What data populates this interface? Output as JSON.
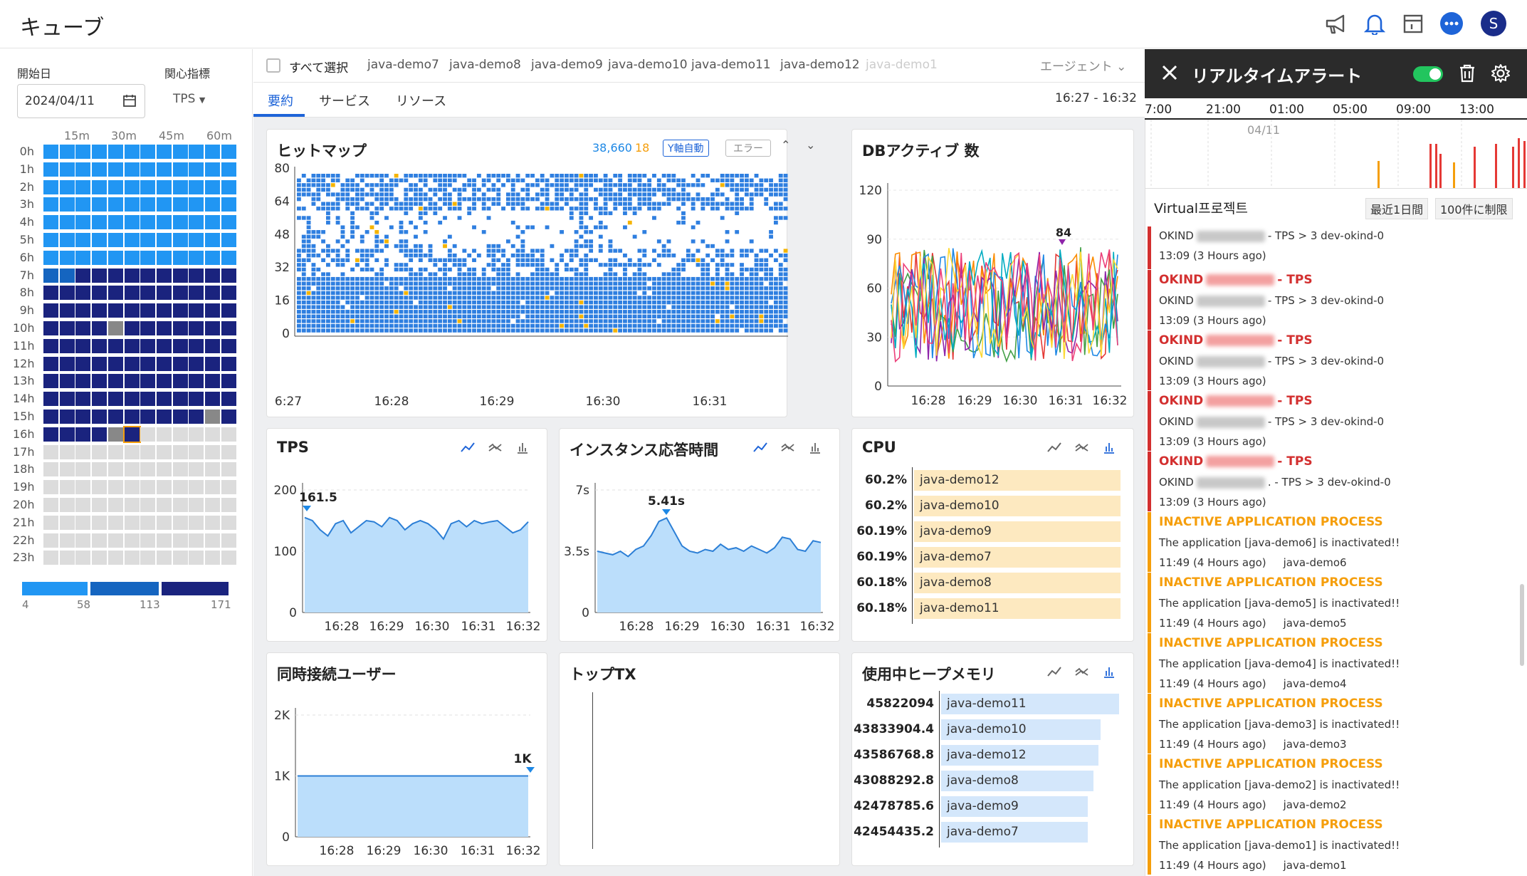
{
  "app": {
    "title": "キューブ"
  },
  "topbar": {
    "icons": [
      "megaphone-icon",
      "bell-icon",
      "calendar-icon",
      "chat-icon",
      "avatar"
    ],
    "avatar_letter": "S"
  },
  "left": {
    "start_date_label": "開始日",
    "metric_label": "関心指標",
    "date": "2024/04/11",
    "metric": "TPS",
    "col_labels": [
      "15m",
      "30m",
      "45m",
      "60m"
    ],
    "row_labels": [
      "0h",
      "1h",
      "2h",
      "3h",
      "4h",
      "5h",
      "6h",
      "7h",
      "8h",
      "9h",
      "10h",
      "11h",
      "12h",
      "13h",
      "14h",
      "15h",
      "16h",
      "17h",
      "18h",
      "19h",
      "20h",
      "21h",
      "22h",
      "23h"
    ],
    "legend": [
      "4",
      "58",
      "113",
      "171"
    ]
  },
  "agents": {
    "select_all": "すべて選択",
    "items": [
      "java-demo7",
      "java-demo8",
      "java-demo9",
      "java-demo10",
      "java-demo11",
      "java-demo12",
      "java-demo1"
    ],
    "dropdown": "エージェント"
  },
  "tabs": {
    "items": [
      "要約",
      "サービス",
      "リソース"
    ],
    "time_range": "16:27 - 16:32"
  },
  "heatmap": {
    "title": "ヒットマップ",
    "count_total": "38,660",
    "count_error": "18",
    "yaxis_badge": "Y軸自動",
    "error_badge": "エラー"
  },
  "db_active": {
    "title": "DBアクティブ 数"
  },
  "tps": {
    "title": "TPS"
  },
  "resp": {
    "title": "インスタンス応答時間"
  },
  "cpu": {
    "title": "CPU"
  },
  "users": {
    "title": "同時接続ユーザー"
  },
  "toptx": {
    "title": "トップTX"
  },
  "heap": {
    "title": "使用中ヒープメモリ"
  },
  "chart_data": [
    {
      "type": "heatmap",
      "title": "ヒットマップ",
      "x_ticks": [
        "6:27",
        "16:28",
        "16:29",
        "16:30",
        "16:31",
        "16:32"
      ],
      "y_ticks": [
        0,
        16,
        32,
        48,
        64,
        80
      ],
      "ylim": [
        0,
        80
      ]
    },
    {
      "type": "line",
      "title": "DBアクティブ 数",
      "x_ticks": [
        "16:28",
        "16:29",
        "16:30",
        "16:31",
        "16:32"
      ],
      "y_ticks": [
        0,
        30,
        60,
        90,
        120
      ],
      "ylim": [
        0,
        120
      ],
      "peak_label": 84,
      "series_colors": [
        "#e53935",
        "#fb8c00",
        "#43a047",
        "#1e88e5",
        "#8e24aa",
        "#00acc1",
        "#fdd835",
        "#ec407a"
      ]
    },
    {
      "type": "area",
      "title": "TPS",
      "x": [
        "16:28",
        "16:29",
        "16:30",
        "16:31",
        "16:32"
      ],
      "y_ticks": [
        "0",
        "100",
        "200"
      ],
      "ylim": [
        0,
        200
      ],
      "values": [
        155,
        150,
        135,
        125,
        145,
        150,
        130,
        140,
        150,
        148,
        140,
        155,
        150,
        135,
        145,
        150,
        145,
        135,
        120,
        145,
        150,
        140,
        150,
        145,
        148,
        150,
        140,
        130,
        135,
        148
      ],
      "peak_label": "161.5"
    },
    {
      "type": "area",
      "title": "インスタンス応答時間",
      "x": [
        "16:28",
        "16:29",
        "16:30",
        "16:31",
        "16:32"
      ],
      "y_ticks": [
        "0",
        "3.5s",
        "7s"
      ],
      "ylim": [
        0,
        7
      ],
      "values": [
        3.5,
        3.4,
        3.3,
        3.5,
        3.2,
        3.6,
        3.8,
        4.4,
        5.2,
        5.4,
        4.6,
        3.8,
        3.5,
        3.4,
        3.6,
        3.5,
        3.9,
        3.6,
        3.7,
        3.5,
        3.8,
        3.6,
        3.4,
        3.7,
        4.3,
        4.2,
        3.6,
        3.5,
        4.1,
        4.0
      ],
      "peak_label": "5.41s"
    },
    {
      "type": "bar",
      "title": "CPU",
      "categories": [
        "java-demo12",
        "java-demo10",
        "java-demo9",
        "java-demo7",
        "java-demo8",
        "java-demo11"
      ],
      "labels": [
        "60.2%",
        "60.2%",
        "60.19%",
        "60.19%",
        "60.18%",
        "60.18%"
      ],
      "values": [
        60.2,
        60.2,
        60.19,
        60.19,
        60.18,
        60.18
      ]
    },
    {
      "type": "area",
      "title": "同時接続ユーザー",
      "x": [
        "16:28",
        "16:29",
        "16:30",
        "16:31",
        "16:32"
      ],
      "y_ticks": [
        "0",
        "1K",
        "2K"
      ],
      "ylim": [
        0,
        2000
      ],
      "values": [
        1000,
        1000,
        1000,
        1000,
        1000
      ],
      "peak_label": "1K"
    },
    {
      "type": "bar",
      "title": "使用中ヒープメモリ",
      "categories": [
        "java-demo11",
        "java-demo10",
        "java-demo12",
        "java-demo8",
        "java-demo9",
        "java-demo7"
      ],
      "labels": [
        "45822094",
        "43833904.4",
        "43586768.8",
        "43088292.8",
        "42478785.6",
        "42454435.2"
      ],
      "values": [
        45822094,
        43833904.4,
        43586768.8,
        43088292.8,
        42478785.6,
        42454435.2
      ]
    }
  ],
  "alerts": {
    "title": "リアルタイムアラート",
    "timeline_ticks": [
      "7:00",
      "21:00",
      "01:00",
      "05:00",
      "09:00",
      "13:00"
    ],
    "timeline_date": "04/11",
    "project": "Virtual프로젝트",
    "range_btn": "最近1日間",
    "limit_btn": "100件に制限",
    "events": [
      {
        "type": "tps",
        "head": "",
        "line": "OKIND",
        "suffix": "- TPS > 3 dev-okind-0",
        "time": "13:09 (3 Hours ago)",
        "agent": ""
      },
      {
        "type": "tps",
        "head": "OKIND",
        "head2": "- TPS",
        "line": "OKIND",
        "suffix": "- TPS > 3 dev-okind-0",
        "time": "13:09 (3 Hours ago)",
        "agent": ""
      },
      {
        "type": "tps",
        "head": "OKIND",
        "head2": "- TPS",
        "line": "OKIND",
        "suffix": "- TPS > 3 dev-okind-0",
        "time": "13:09 (3 Hours ago)",
        "agent": ""
      },
      {
        "type": "tps",
        "head": "OKIND",
        "head2": "- TPS",
        "line": "OKIND",
        "suffix": "- TPS > 3 dev-okind-0",
        "time": "13:09 (3 Hours ago)",
        "agent": ""
      },
      {
        "type": "tps",
        "head": "OKIND",
        "head2": "- TPS",
        "line": "OKIND",
        "suffix": ". - TPS > 3 dev-okind-0",
        "time": "13:09 (3 Hours ago)",
        "agent": ""
      },
      {
        "type": "inactive",
        "head": "INACTIVE APPLICATION PROCESS",
        "line": "The application [java-demo6] is inactivated!!",
        "time": "11:49 (4 Hours ago)",
        "agent": "java-demo6"
      },
      {
        "type": "inactive",
        "head": "INACTIVE APPLICATION PROCESS",
        "line": "The application [java-demo5] is inactivated!!",
        "time": "11:49 (4 Hours ago)",
        "agent": "java-demo5"
      },
      {
        "type": "inactive",
        "head": "INACTIVE APPLICATION PROCESS",
        "line": "The application [java-demo4] is inactivated!!",
        "time": "11:49 (4 Hours ago)",
        "agent": "java-demo4"
      },
      {
        "type": "inactive",
        "head": "INACTIVE APPLICATION PROCESS",
        "line": "The application [java-demo3] is inactivated!!",
        "time": "11:49 (4 Hours ago)",
        "agent": "java-demo3"
      },
      {
        "type": "inactive",
        "head": "INACTIVE APPLICATION PROCESS",
        "line": "The application [java-demo2] is inactivated!!",
        "time": "11:49 (4 Hours ago)",
        "agent": "java-demo2"
      },
      {
        "type": "inactive",
        "head": "INACTIVE APPLICATION PROCESS",
        "line": "The application [java-demo1] is inactivated!!",
        "time": "11:49 (4 Hours ago)",
        "agent": "java-demo1"
      }
    ]
  }
}
